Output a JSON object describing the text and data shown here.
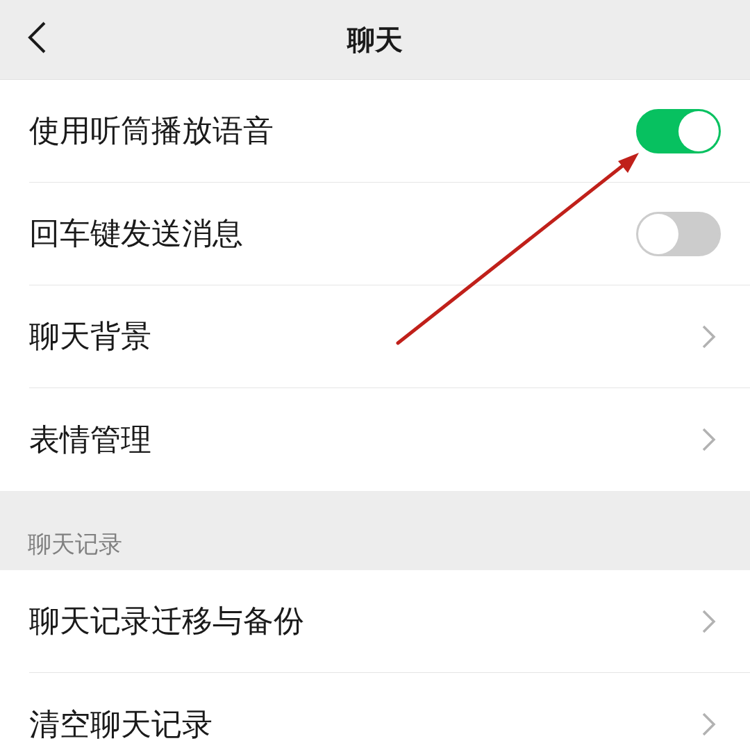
{
  "header": {
    "title": "聊天"
  },
  "groups": [
    {
      "items": [
        {
          "label": "使用听筒播放语音",
          "kind": "toggle",
          "on": true
        },
        {
          "label": "回车键发送消息",
          "kind": "toggle",
          "on": false
        },
        {
          "label": "聊天背景",
          "kind": "link"
        },
        {
          "label": "表情管理",
          "kind": "link"
        }
      ]
    },
    {
      "title": "聊天记录",
      "items": [
        {
          "label": "聊天记录迁移与备份",
          "kind": "link"
        },
        {
          "label": "清空聊天记录",
          "kind": "link"
        }
      ]
    }
  ],
  "overlay": {
    "kind": "arrow"
  }
}
